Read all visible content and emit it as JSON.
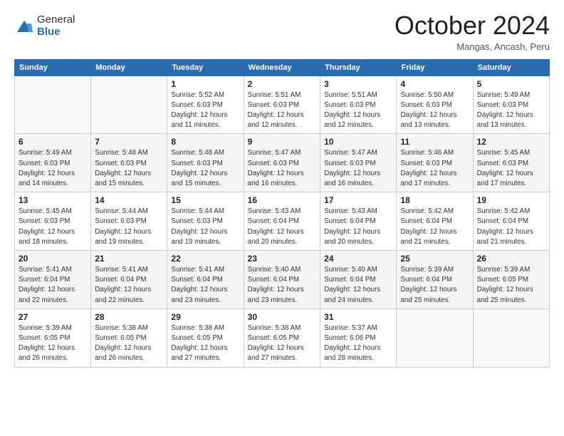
{
  "header": {
    "logo_general": "General",
    "logo_blue": "Blue",
    "month_title": "October 2024",
    "location": "Mangas, Ancash, Peru"
  },
  "calendar": {
    "weekdays": [
      "Sunday",
      "Monday",
      "Tuesday",
      "Wednesday",
      "Thursday",
      "Friday",
      "Saturday"
    ],
    "weeks": [
      [
        {
          "day": "",
          "sunrise": "",
          "sunset": "",
          "daylight": ""
        },
        {
          "day": "",
          "sunrise": "",
          "sunset": "",
          "daylight": ""
        },
        {
          "day": "1",
          "sunrise": "Sunrise: 5:52 AM",
          "sunset": "Sunset: 6:03 PM",
          "daylight": "Daylight: 12 hours and 11 minutes."
        },
        {
          "day": "2",
          "sunrise": "Sunrise: 5:51 AM",
          "sunset": "Sunset: 6:03 PM",
          "daylight": "Daylight: 12 hours and 12 minutes."
        },
        {
          "day": "3",
          "sunrise": "Sunrise: 5:51 AM",
          "sunset": "Sunset: 6:03 PM",
          "daylight": "Daylight: 12 hours and 12 minutes."
        },
        {
          "day": "4",
          "sunrise": "Sunrise: 5:50 AM",
          "sunset": "Sunset: 6:03 PM",
          "daylight": "Daylight: 12 hours and 13 minutes."
        },
        {
          "day": "5",
          "sunrise": "Sunrise: 5:49 AM",
          "sunset": "Sunset: 6:03 PM",
          "daylight": "Daylight: 12 hours and 13 minutes."
        }
      ],
      [
        {
          "day": "6",
          "sunrise": "Sunrise: 5:49 AM",
          "sunset": "Sunset: 6:03 PM",
          "daylight": "Daylight: 12 hours and 14 minutes."
        },
        {
          "day": "7",
          "sunrise": "Sunrise: 5:48 AM",
          "sunset": "Sunset: 6:03 PM",
          "daylight": "Daylight: 12 hours and 15 minutes."
        },
        {
          "day": "8",
          "sunrise": "Sunrise: 5:48 AM",
          "sunset": "Sunset: 6:03 PM",
          "daylight": "Daylight: 12 hours and 15 minutes."
        },
        {
          "day": "9",
          "sunrise": "Sunrise: 5:47 AM",
          "sunset": "Sunset: 6:03 PM",
          "daylight": "Daylight: 12 hours and 16 minutes."
        },
        {
          "day": "10",
          "sunrise": "Sunrise: 5:47 AM",
          "sunset": "Sunset: 6:03 PM",
          "daylight": "Daylight: 12 hours and 16 minutes."
        },
        {
          "day": "11",
          "sunrise": "Sunrise: 5:46 AM",
          "sunset": "Sunset: 6:03 PM",
          "daylight": "Daylight: 12 hours and 17 minutes."
        },
        {
          "day": "12",
          "sunrise": "Sunrise: 5:45 AM",
          "sunset": "Sunset: 6:03 PM",
          "daylight": "Daylight: 12 hours and 17 minutes."
        }
      ],
      [
        {
          "day": "13",
          "sunrise": "Sunrise: 5:45 AM",
          "sunset": "Sunset: 6:03 PM",
          "daylight": "Daylight: 12 hours and 18 minutes."
        },
        {
          "day": "14",
          "sunrise": "Sunrise: 5:44 AM",
          "sunset": "Sunset: 6:03 PM",
          "daylight": "Daylight: 12 hours and 19 minutes."
        },
        {
          "day": "15",
          "sunrise": "Sunrise: 5:44 AM",
          "sunset": "Sunset: 6:03 PM",
          "daylight": "Daylight: 12 hours and 19 minutes."
        },
        {
          "day": "16",
          "sunrise": "Sunrise: 5:43 AM",
          "sunset": "Sunset: 6:04 PM",
          "daylight": "Daylight: 12 hours and 20 minutes."
        },
        {
          "day": "17",
          "sunrise": "Sunrise: 5:43 AM",
          "sunset": "Sunset: 6:04 PM",
          "daylight": "Daylight: 12 hours and 20 minutes."
        },
        {
          "day": "18",
          "sunrise": "Sunrise: 5:42 AM",
          "sunset": "Sunset: 6:04 PM",
          "daylight": "Daylight: 12 hours and 21 minutes."
        },
        {
          "day": "19",
          "sunrise": "Sunrise: 5:42 AM",
          "sunset": "Sunset: 6:04 PM",
          "daylight": "Daylight: 12 hours and 21 minutes."
        }
      ],
      [
        {
          "day": "20",
          "sunrise": "Sunrise: 5:41 AM",
          "sunset": "Sunset: 6:04 PM",
          "daylight": "Daylight: 12 hours and 22 minutes."
        },
        {
          "day": "21",
          "sunrise": "Sunrise: 5:41 AM",
          "sunset": "Sunset: 6:04 PM",
          "daylight": "Daylight: 12 hours and 22 minutes."
        },
        {
          "day": "22",
          "sunrise": "Sunrise: 5:41 AM",
          "sunset": "Sunset: 6:04 PM",
          "daylight": "Daylight: 12 hours and 23 minutes."
        },
        {
          "day": "23",
          "sunrise": "Sunrise: 5:40 AM",
          "sunset": "Sunset: 6:04 PM",
          "daylight": "Daylight: 12 hours and 23 minutes."
        },
        {
          "day": "24",
          "sunrise": "Sunrise: 5:40 AM",
          "sunset": "Sunset: 6:04 PM",
          "daylight": "Daylight: 12 hours and 24 minutes."
        },
        {
          "day": "25",
          "sunrise": "Sunrise: 5:39 AM",
          "sunset": "Sunset: 6:04 PM",
          "daylight": "Daylight: 12 hours and 25 minutes."
        },
        {
          "day": "26",
          "sunrise": "Sunrise: 5:39 AM",
          "sunset": "Sunset: 6:05 PM",
          "daylight": "Daylight: 12 hours and 25 minutes."
        }
      ],
      [
        {
          "day": "27",
          "sunrise": "Sunrise: 5:39 AM",
          "sunset": "Sunset: 6:05 PM",
          "daylight": "Daylight: 12 hours and 26 minutes."
        },
        {
          "day": "28",
          "sunrise": "Sunrise: 5:38 AM",
          "sunset": "Sunset: 6:05 PM",
          "daylight": "Daylight: 12 hours and 26 minutes."
        },
        {
          "day": "29",
          "sunrise": "Sunrise: 5:38 AM",
          "sunset": "Sunset: 6:05 PM",
          "daylight": "Daylight: 12 hours and 27 minutes."
        },
        {
          "day": "30",
          "sunrise": "Sunrise: 5:38 AM",
          "sunset": "Sunset: 6:05 PM",
          "daylight": "Daylight: 12 hours and 27 minutes."
        },
        {
          "day": "31",
          "sunrise": "Sunrise: 5:37 AM",
          "sunset": "Sunset: 6:06 PM",
          "daylight": "Daylight: 12 hours and 28 minutes."
        },
        {
          "day": "",
          "sunrise": "",
          "sunset": "",
          "daylight": ""
        },
        {
          "day": "",
          "sunrise": "",
          "sunset": "",
          "daylight": ""
        }
      ]
    ]
  }
}
